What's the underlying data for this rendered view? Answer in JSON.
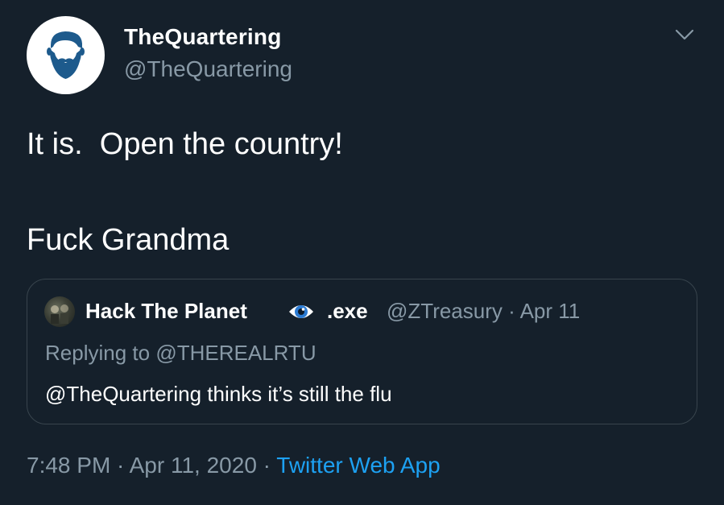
{
  "author": {
    "display_name": "TheQuartering",
    "handle": "@TheQuartering"
  },
  "tweet": {
    "line1": "It is.  Open the country!",
    "line2": "Fuck Grandma"
  },
  "quoted": {
    "name": "Hack The Planet",
    "name_suffix": ".exe",
    "eye_icon": "eye-emoji",
    "handle": "@ZTreasury",
    "date": "Apr 11",
    "meta_sep": " · ",
    "reply_prefix": "Replying to ",
    "reply_to": "@THEREALRTU",
    "text": "@TheQuartering thinks it’s still the flu"
  },
  "footer": {
    "time": "7:48 PM",
    "date": "Apr 11, 2020",
    "sep": " · ",
    "source": "Twitter Web App"
  },
  "colors": {
    "background": "#15202b",
    "secondary_text": "#8899a6",
    "link": "#1da1f2",
    "border": "#38444d",
    "avatar_blue": "#1d5a8c"
  }
}
